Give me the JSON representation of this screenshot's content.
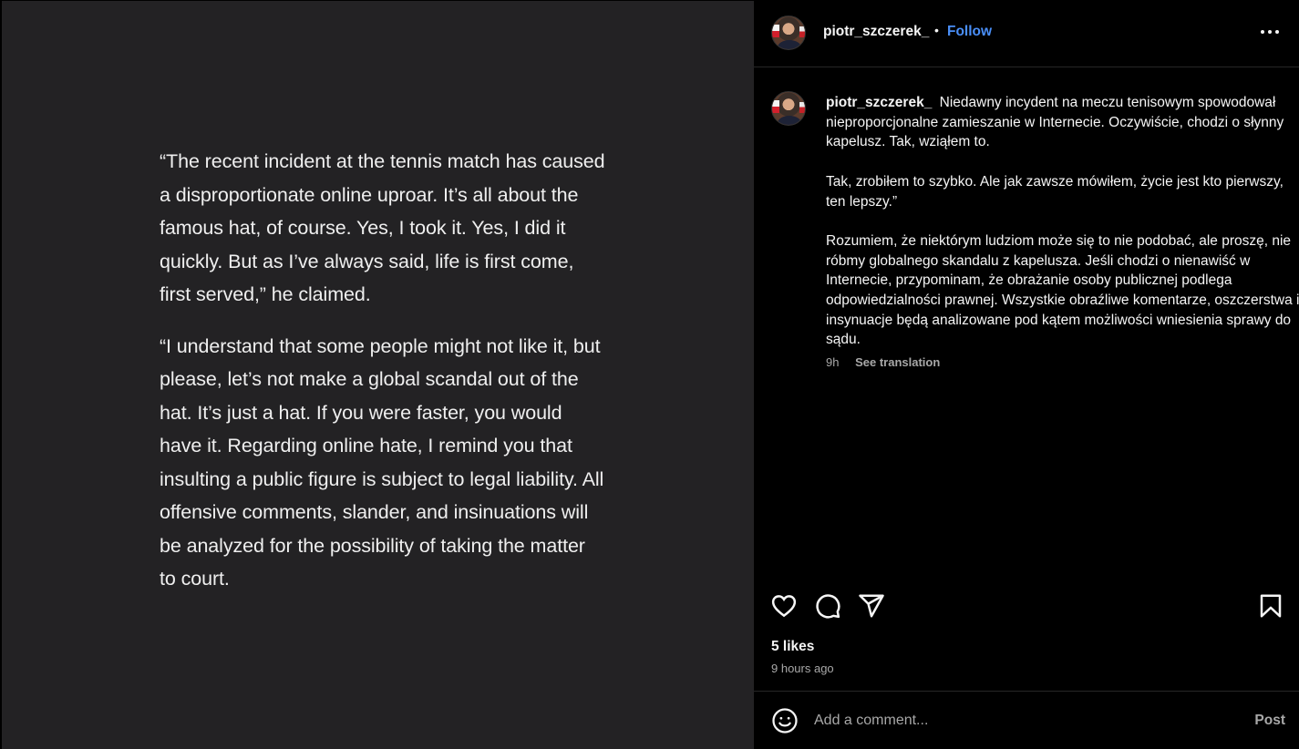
{
  "post_image": {
    "paragraphs": [
      "“The recent incident at the tennis match has caused a disproportionate online uproar. It’s all about the famous hat, of course. Yes, I took it. Yes, I did it quickly. But as I’ve always said, life is first come, first served,” he claimed.",
      "“I understand that some people might not like it, but please, let’s not make a global scandal out of the hat. It’s just a hat. If you were faster, you would have it. Regarding online hate, I remind you that insulting a public figure is subject to legal liability. All offensive comments, slander, and insinuations will be analyzed for the possibility of taking the matter to court."
    ]
  },
  "header": {
    "username": "piotr_szczerek_",
    "separator": "•",
    "follow_label": "Follow",
    "more_icon": "more-horizontal-icon"
  },
  "caption": {
    "username": "piotr_szczerek_",
    "paragraphs": [
      "Niedawny incydent na meczu tenisowym spowodował nieproporcjonalne zamieszanie w Internecie. Oczywiście, chodzi o słynny kapelusz. Tak, wziąłem to.",
      "Tak, zrobiłem to szybko. Ale jak zawsze mówiłem, życie jest kto pierwszy, ten lepszy.”",
      "Rozumiem, że niektórym ludziom może się to nie podobać, ale proszę, nie róbmy globalnego skandalu z kapelusza. Jeśli chodzi o nienawiść w Internecie, przypominam, że obrażanie osoby publicznej podlega odpowiedzialności prawnej. Wszystkie obraźliwe komentarze, oszczerstwa i insynuacje będą analizowane pod kątem możliwości wniesienia sprawy do sądu."
    ],
    "time": "9h",
    "see_translation": "See translation"
  },
  "actions": {
    "icons": [
      "heart-icon",
      "comment-icon",
      "share-icon",
      "bookmark-icon"
    ]
  },
  "stats": {
    "likes": "5 likes",
    "posted_ago": "9 hours ago"
  },
  "comment": {
    "placeholder": "Add a comment...",
    "post_label": "Post",
    "emoji_icon": "emoji-icon"
  },
  "colors": {
    "image_bg": "#232224",
    "panel_bg": "#000000",
    "link_blue": "#4a8ff8",
    "muted": "#a8a8a8"
  }
}
